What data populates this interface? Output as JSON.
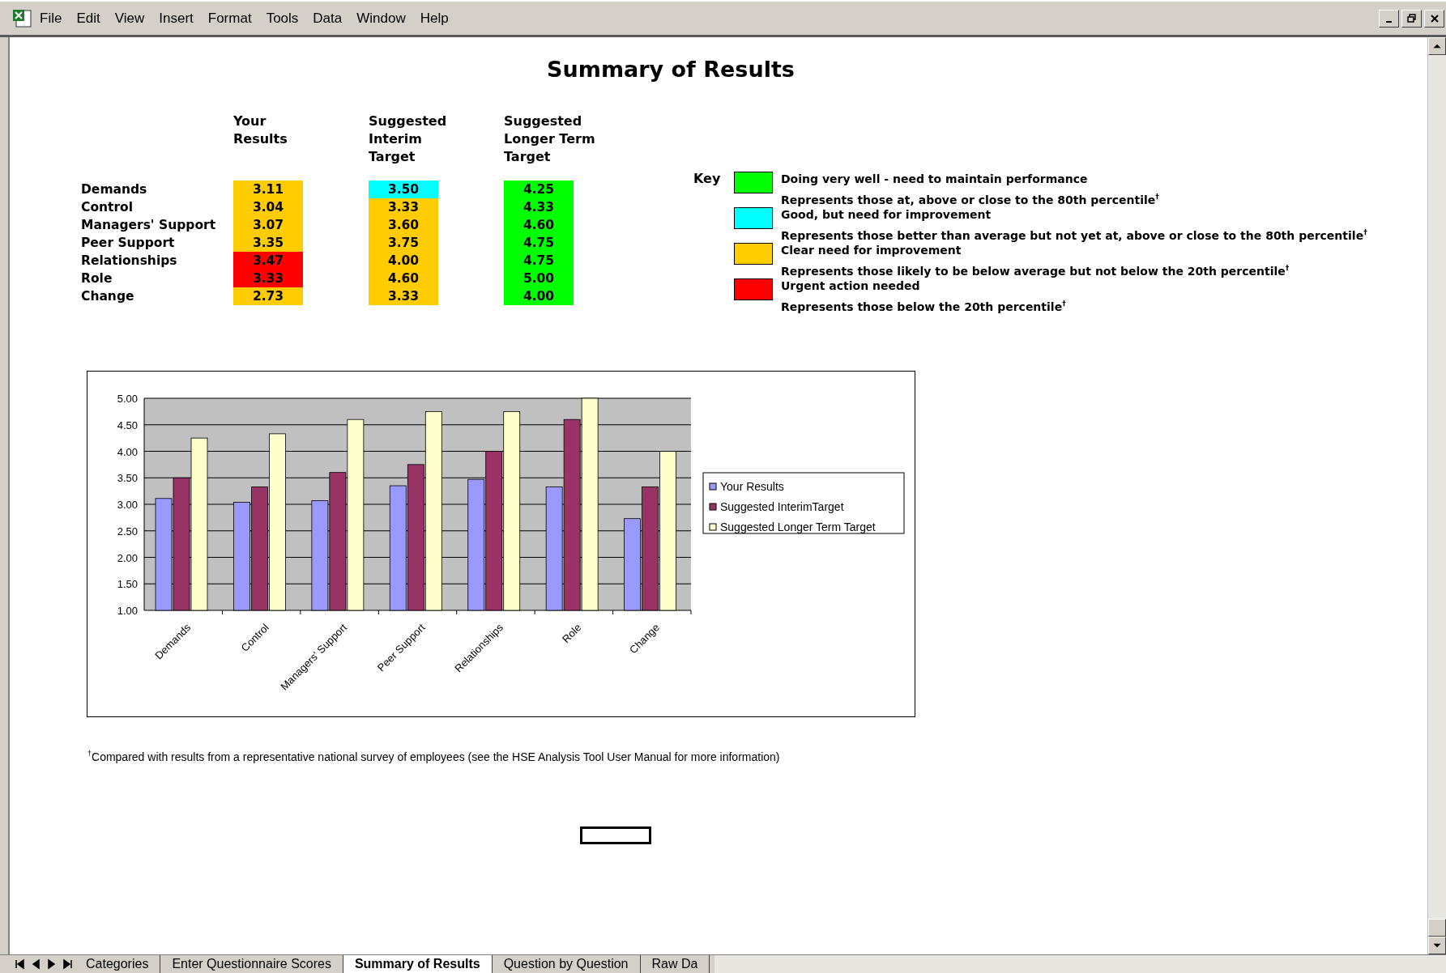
{
  "menu": [
    "File",
    "Edit",
    "View",
    "Insert",
    "Format",
    "Tools",
    "Data",
    "Window",
    "Help"
  ],
  "title": "Summary of Results",
  "table": {
    "columns": [
      "Your\nResults",
      "Suggested\nInterim\nTarget",
      "Suggested\nLonger Term\nTarget"
    ],
    "rows": [
      {
        "label": "Demands",
        "cells": [
          {
            "value": "3.11",
            "color": "#ffcc00"
          },
          {
            "value": "3.50",
            "color": "#00ffff"
          },
          {
            "value": "4.25",
            "color": "#00ff00"
          }
        ]
      },
      {
        "label": "Control",
        "cells": [
          {
            "value": "3.04",
            "color": "#ffcc00"
          },
          {
            "value": "3.33",
            "color": "#ffcc00"
          },
          {
            "value": "4.33",
            "color": "#00ff00"
          }
        ]
      },
      {
        "label": "Managers' Support",
        "cells": [
          {
            "value": "3.07",
            "color": "#ffcc00"
          },
          {
            "value": "3.60",
            "color": "#ffcc00"
          },
          {
            "value": "4.60",
            "color": "#00ff00"
          }
        ]
      },
      {
        "label": "Peer Support",
        "cells": [
          {
            "value": "3.35",
            "color": "#ffcc00"
          },
          {
            "value": "3.75",
            "color": "#ffcc00"
          },
          {
            "value": "4.75",
            "color": "#00ff00"
          }
        ]
      },
      {
        "label": "Relationships",
        "cells": [
          {
            "value": "3.47",
            "color": "#ff0000"
          },
          {
            "value": "4.00",
            "color": "#ffcc00"
          },
          {
            "value": "4.75",
            "color": "#00ff00"
          }
        ]
      },
      {
        "label": "Role",
        "cells": [
          {
            "value": "3.33",
            "color": "#ff0000"
          },
          {
            "value": "4.60",
            "color": "#ffcc00"
          },
          {
            "value": "5.00",
            "color": "#00ff00"
          }
        ]
      },
      {
        "label": "Change",
        "cells": [
          {
            "value": "2.73",
            "color": "#ffcc00"
          },
          {
            "value": "3.33",
            "color": "#ffcc00"
          },
          {
            "value": "4.00",
            "color": "#00ff00"
          }
        ]
      }
    ]
  },
  "key": {
    "label": "Key",
    "items": [
      {
        "color": "#00ff00",
        "title": "Doing very well - need to maintain performance",
        "description": "Represents those at, above or close to the 80th percentile$^{†}$"
      },
      {
        "color": "#00ffff",
        "title": "Good, but need for improvement",
        "description": "Represents those better than average but not yet at, above or close to the 80th percentile$^{†}$"
      },
      {
        "color": "#ffcc00",
        "title": "Clear need for improvement",
        "description": "Represents those likely to be below average but not below the 20th percentile$^{†}$"
      },
      {
        "color": "#ff0000",
        "title": "Urgent action needed",
        "description": "Represents those below the 20th percentile$^{†}$"
      }
    ]
  },
  "chart_data": {
    "type": "bar",
    "categories": [
      "Demands",
      "Control",
      "Managers' Support",
      "Peer Support",
      "Relationships",
      "Role",
      "Change"
    ],
    "series": [
      {
        "name": "Your Results",
        "color": "#9999ff",
        "values": [
          3.11,
          3.04,
          3.07,
          3.35,
          3.47,
          3.33,
          2.73
        ]
      },
      {
        "name": "Suggested InterimTarget",
        "color": "#993366",
        "values": [
          3.5,
          3.33,
          3.6,
          3.75,
          4.0,
          4.6,
          3.33
        ]
      },
      {
        "name": "Suggested Longer Term Target",
        "color": "#ffffcc",
        "values": [
          4.25,
          4.33,
          4.6,
          4.75,
          4.75,
          5.0,
          4.0
        ]
      }
    ],
    "ylim": [
      1,
      5
    ],
    "grid": true,
    "legend": true,
    "yticks": [
      {
        "value": 1,
        "label": "1.00"
      },
      {
        "value": 1.5,
        "label": "1.50"
      },
      {
        "value": 2,
        "label": "2.00"
      },
      {
        "value": 2.5,
        "label": "2.50"
      },
      {
        "value": 3,
        "label": "3.00"
      },
      {
        "value": 3.5,
        "label": "3.50"
      },
      {
        "value": 4,
        "label": "4.00"
      },
      {
        "value": 4.5,
        "label": "4.50"
      },
      {
        "value": 5,
        "label": "5.00"
      }
    ]
  },
  "footnote": "$^{†}$Compared with results from a representative national survey of employees (see the HSE Analysis Tool User Manual for more information)",
  "sheet_tabs": [
    {
      "label": "Categories",
      "selected": false
    },
    {
      "label": "Enter Questionnaire Scores",
      "selected": false
    },
    {
      "label": "Summary of Results",
      "selected": true
    },
    {
      "label": "Question by Question",
      "selected": false
    },
    {
      "label": "Raw Da",
      "selected": false
    }
  ]
}
